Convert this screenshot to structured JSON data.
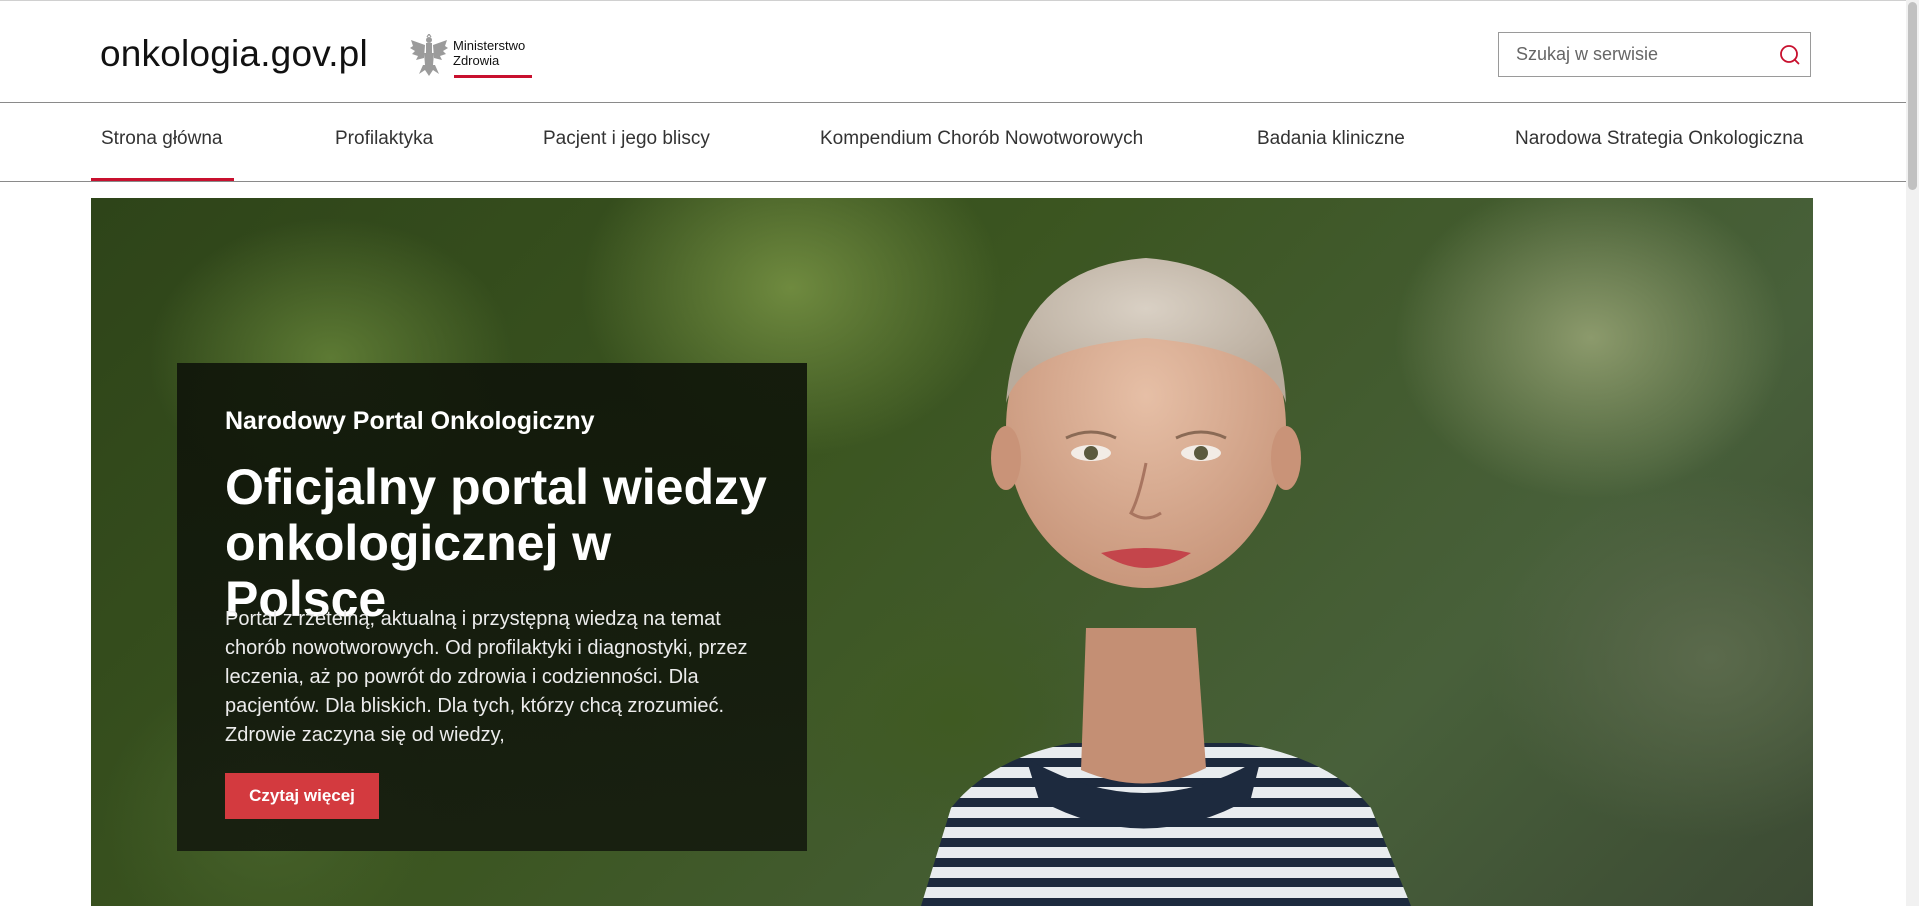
{
  "header": {
    "site_title": "onkologia.gov.pl",
    "ministry_line1": "Ministerstwo",
    "ministry_line2": "Zdrowia",
    "search_placeholder": "Szukaj w serwisie",
    "search_icon": "search-icon"
  },
  "nav": {
    "items": [
      {
        "label": "Strona główna",
        "active": true
      },
      {
        "label": "Profilaktyka",
        "active": false
      },
      {
        "label": "Pacjent i jego bliscy",
        "active": false
      },
      {
        "label": "Kompendium Chorób Nowotworowych",
        "active": false
      },
      {
        "label": "Badania kliniczne",
        "active": false
      },
      {
        "label": "Narodowa Strategia Onkologiczna",
        "active": false
      }
    ]
  },
  "hero": {
    "eyebrow": "Narodowy Portal Onkologiczny",
    "headline": "Oficjalny portal wiedzy onkologicznej w Polsce",
    "lead": "Portal z rzetelną, aktualną i przystępną wiedzą na temat chorób nowotworowych. Od profilaktyki i diagnostyki, przez leczenia, aż po powrót do zdrowia i codzienności. Dla pacjentów. Dla bliskich. Dla tych, którzy chcą zrozumieć. Zdrowie zaczyna się od wiedzy,",
    "cta_label": "Czytaj więcej"
  },
  "colors": {
    "accent_red": "#c8102e",
    "cta_red": "#d33a3f"
  }
}
